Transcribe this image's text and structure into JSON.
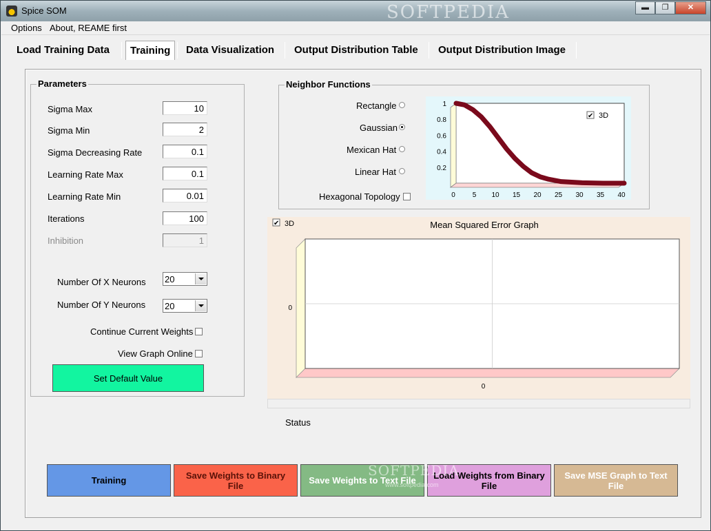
{
  "window": {
    "title": "Spice SOM",
    "watermark": "SOFTPEDIA"
  },
  "window_controls": {
    "minimize": "▬",
    "maximize": "❐",
    "close": "✕"
  },
  "menu": [
    "Options",
    "About, REAME first"
  ],
  "tabs": [
    {
      "label": "Load Training Data",
      "active": false
    },
    {
      "label": "Training",
      "active": true
    },
    {
      "label": "Data Visualization",
      "active": false
    },
    {
      "label": "Output Distribution Table",
      "active": false
    },
    {
      "label": "Output Distribution Image",
      "active": false
    }
  ],
  "parameters": {
    "title": "Parameters",
    "sigma_max": {
      "label": "Sigma Max",
      "value": "10"
    },
    "sigma_min": {
      "label": "Sigma Min",
      "value": "2"
    },
    "sigma_rate": {
      "label": "Sigma Decreasing Rate",
      "value": "0.1"
    },
    "lr_max": {
      "label": "Learning Rate Max",
      "value": "0.1"
    },
    "lr_min": {
      "label": "Learning Rate Min",
      "value": "0.01"
    },
    "iterations": {
      "label": "Iterations",
      "value": "100"
    },
    "inhibition": {
      "label": "Inhibition",
      "value": "1"
    },
    "x_neurons": {
      "label": "Number Of X Neurons",
      "value": "20"
    },
    "y_neurons": {
      "label": "Number Of Y Neurons",
      "value": "20"
    },
    "continue_weights": {
      "label": "Continue Current Weights",
      "checked": false
    },
    "view_graph": {
      "label": "View Graph Online",
      "checked": false
    },
    "default_button": "Set Default Value"
  },
  "neighbor": {
    "title": "Neighbor Functions",
    "options": [
      {
        "label": "Rectangle",
        "selected": false
      },
      {
        "label": "Gaussian",
        "selected": true
      },
      {
        "label": "Mexican Hat",
        "selected": false
      },
      {
        "label": "Linear Hat",
        "selected": false
      }
    ],
    "hexagonal": {
      "label": "Hexagonal Topology",
      "checked": false
    }
  },
  "chart_data": [
    {
      "type": "line",
      "title": "",
      "xlabel": "",
      "ylabel": "",
      "three_d_label": "3D",
      "three_d_checked": true,
      "xlim": [
        0,
        40
      ],
      "ylim": [
        0,
        1
      ],
      "x_ticks": [
        "0",
        "5",
        "10",
        "15",
        "20",
        "25",
        "30",
        "35",
        "40"
      ],
      "y_ticks": [
        "1",
        "0.8",
        "0.6",
        "0.4",
        "0.2"
      ],
      "color": "#7a0a1c",
      "x": [
        0,
        2,
        4,
        6,
        8,
        10,
        12,
        14,
        16,
        18,
        20,
        22,
        25,
        30,
        35,
        40
      ],
      "values": [
        1,
        0.98,
        0.92,
        0.83,
        0.71,
        0.57,
        0.43,
        0.31,
        0.21,
        0.13,
        0.08,
        0.05,
        0.02,
        0.005,
        0,
        0
      ]
    },
    {
      "type": "line",
      "title": "Mean Squared Error Graph",
      "xlabel": "",
      "ylabel": "",
      "three_d_label": "3D",
      "three_d_checked": true,
      "x_ticks": [
        "0"
      ],
      "y_ticks": [
        "0"
      ],
      "x": [],
      "values": []
    }
  ],
  "status": {
    "label": "Status"
  },
  "buttons": [
    {
      "label": "Training",
      "color": "#6497e6"
    },
    {
      "label": "Save Weights to Binary File",
      "color": "#fa6349"
    },
    {
      "label": "Save Weights to Text File",
      "color": "#84ba84"
    },
    {
      "label": "Load Weights from Binary File",
      "color": "#dfa0dd"
    },
    {
      "label": "Save MSE Graph to Text File",
      "color": "#d6b994"
    }
  ],
  "bottom_watermark": {
    "text": "SOFTPEDIA",
    "url": "www.softpedia.com"
  }
}
